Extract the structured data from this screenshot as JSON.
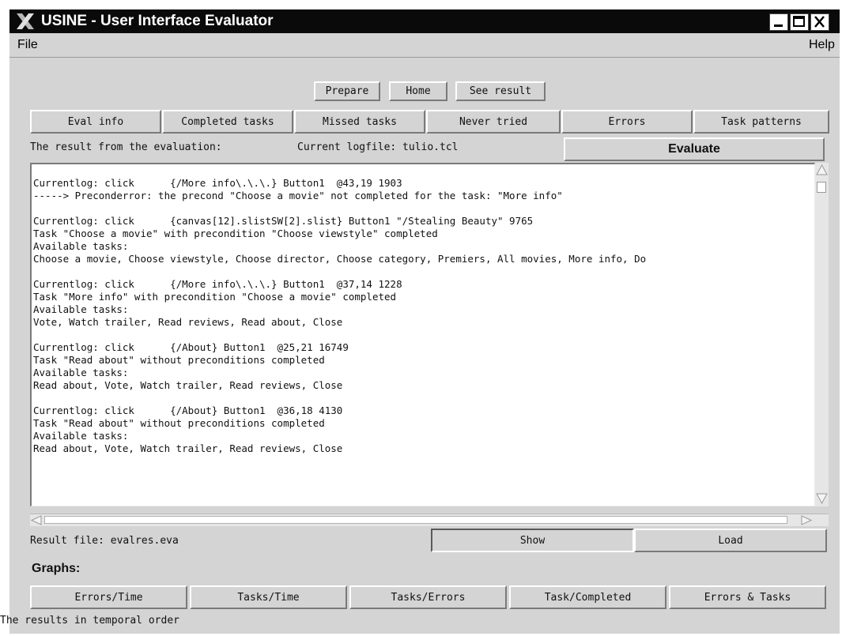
{
  "window": {
    "title": "USINE - User Interface Evaluator",
    "logo_icon": "x-logo-icon",
    "controls": [
      "minimize-icon",
      "maximize-icon",
      "close-icon"
    ]
  },
  "menu": {
    "file": "File",
    "help": "Help"
  },
  "top_buttons": {
    "prepare": "Prepare",
    "home": "Home",
    "see_result": "See result"
  },
  "tabs": [
    "Eval info",
    "Completed tasks",
    "Missed tasks",
    "Never tried",
    "Errors",
    "Task patterns"
  ],
  "status": {
    "result_label": "The result from the evaluation:",
    "logfile_label": "Current logfile: tulio.tcl",
    "evaluate_button": "Evaluate"
  },
  "log_blocks": [
    [
      "Currentlog: click      {/More info\\.\\.\\.} Button1  @43,19 1903",
      "-----> Preconderror: the precond \"Choose a movie\" not completed for the task: \"More info\""
    ],
    [
      "Currentlog: click      {canvas[12].slistSW[2].slist} Button1 \"/Stealing Beauty\" 9765",
      "Task \"Choose a movie\" with precondition \"Choose viewstyle\" completed",
      "Available tasks:",
      "Choose a movie, Choose viewstyle, Choose director, Choose category, Premiers, All movies, More info, Do"
    ],
    [
      "Currentlog: click      {/More info\\.\\.\\.} Button1  @37,14 1228",
      "Task \"More info\" with precondition \"Choose a movie\" completed",
      "Available tasks:",
      "Vote, Watch trailer, Read reviews, Read about, Close"
    ],
    [
      "Currentlog: click      {/About} Button1  @25,21 16749",
      "Task \"Read about\" without preconditions completed",
      "Available tasks:",
      "Read about, Vote, Watch trailer, Read reviews, Close"
    ],
    [
      "Currentlog: click      {/About} Button1  @36,18 4130",
      "Task \"Read about\" without preconditions completed",
      "Available tasks:",
      "Read about, Vote, Watch trailer, Read reviews, Close"
    ]
  ],
  "result": {
    "file_label": "Result file: evalres.eva",
    "show_button": "Show",
    "load_button": "Load"
  },
  "graphs": {
    "label": "Graphs:",
    "buttons": [
      "Errors/Time",
      "Tasks/Time",
      "Tasks/Errors",
      "Task/Completed",
      "Errors & Tasks"
    ]
  },
  "statusbar": {
    "text": "The results in temporal order"
  }
}
